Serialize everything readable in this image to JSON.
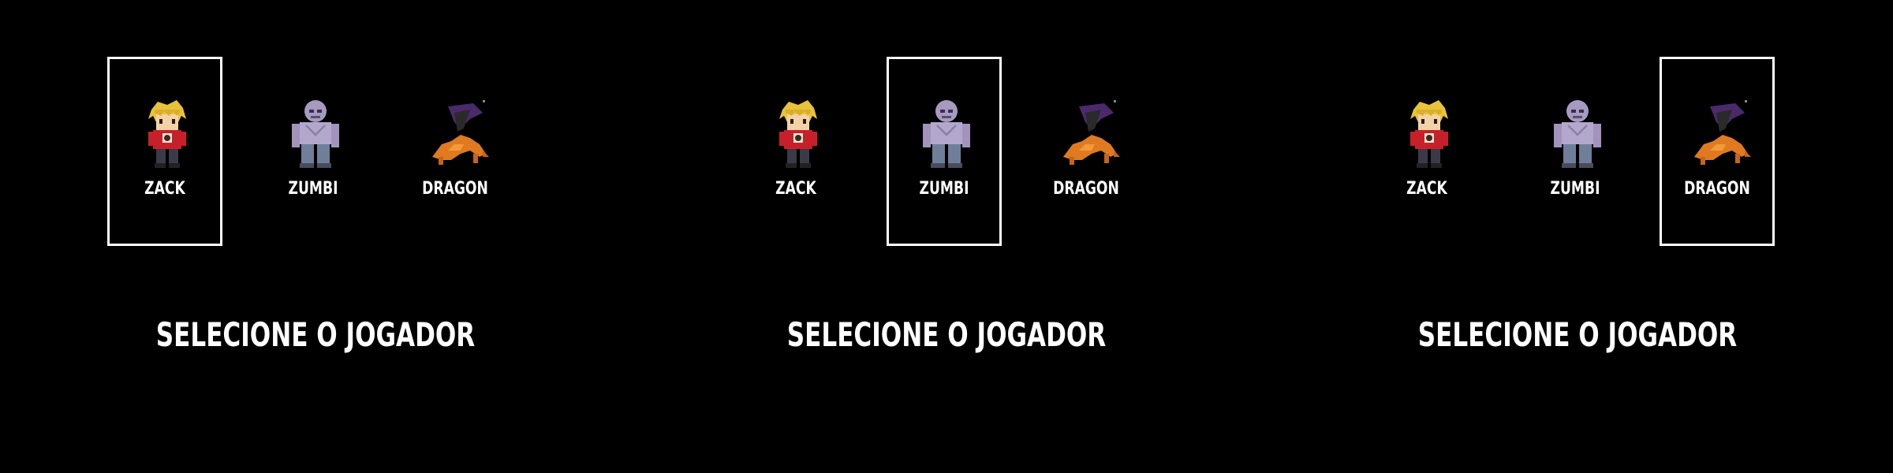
{
  "screens": [
    {
      "selected": "zack",
      "prompt": "SELECIONE O JOGADOR",
      "characters": [
        {
          "id": "zack",
          "name": "ZACK",
          "icon": "zack-sprite-icon"
        },
        {
          "id": "zumbi",
          "name": "ZUMBI",
          "icon": "zombie-sprite-icon"
        },
        {
          "id": "dragon",
          "name": "DRAGON",
          "icon": "dragon-sprite-icon"
        }
      ]
    },
    {
      "selected": "zumbi",
      "prompt": "SELECIONE O JOGADOR",
      "characters": [
        {
          "id": "zack",
          "name": "ZACK",
          "icon": "zack-sprite-icon"
        },
        {
          "id": "zumbi",
          "name": "ZUMBI",
          "icon": "zombie-sprite-icon"
        },
        {
          "id": "dragon",
          "name": "DRAGON",
          "icon": "dragon-sprite-icon"
        }
      ]
    },
    {
      "selected": "dragon",
      "prompt": "SELECIONE O JOGADOR",
      "characters": [
        {
          "id": "zack",
          "name": "ZACK",
          "icon": "zack-sprite-icon"
        },
        {
          "id": "zumbi",
          "name": "ZUMBI",
          "icon": "zombie-sprite-icon"
        },
        {
          "id": "dragon",
          "name": "DRAGON",
          "icon": "dragon-sprite-icon"
        }
      ]
    }
  ],
  "colors": {
    "background": "#000000",
    "text": "#ffffff",
    "selection_border": "#ffffff"
  }
}
